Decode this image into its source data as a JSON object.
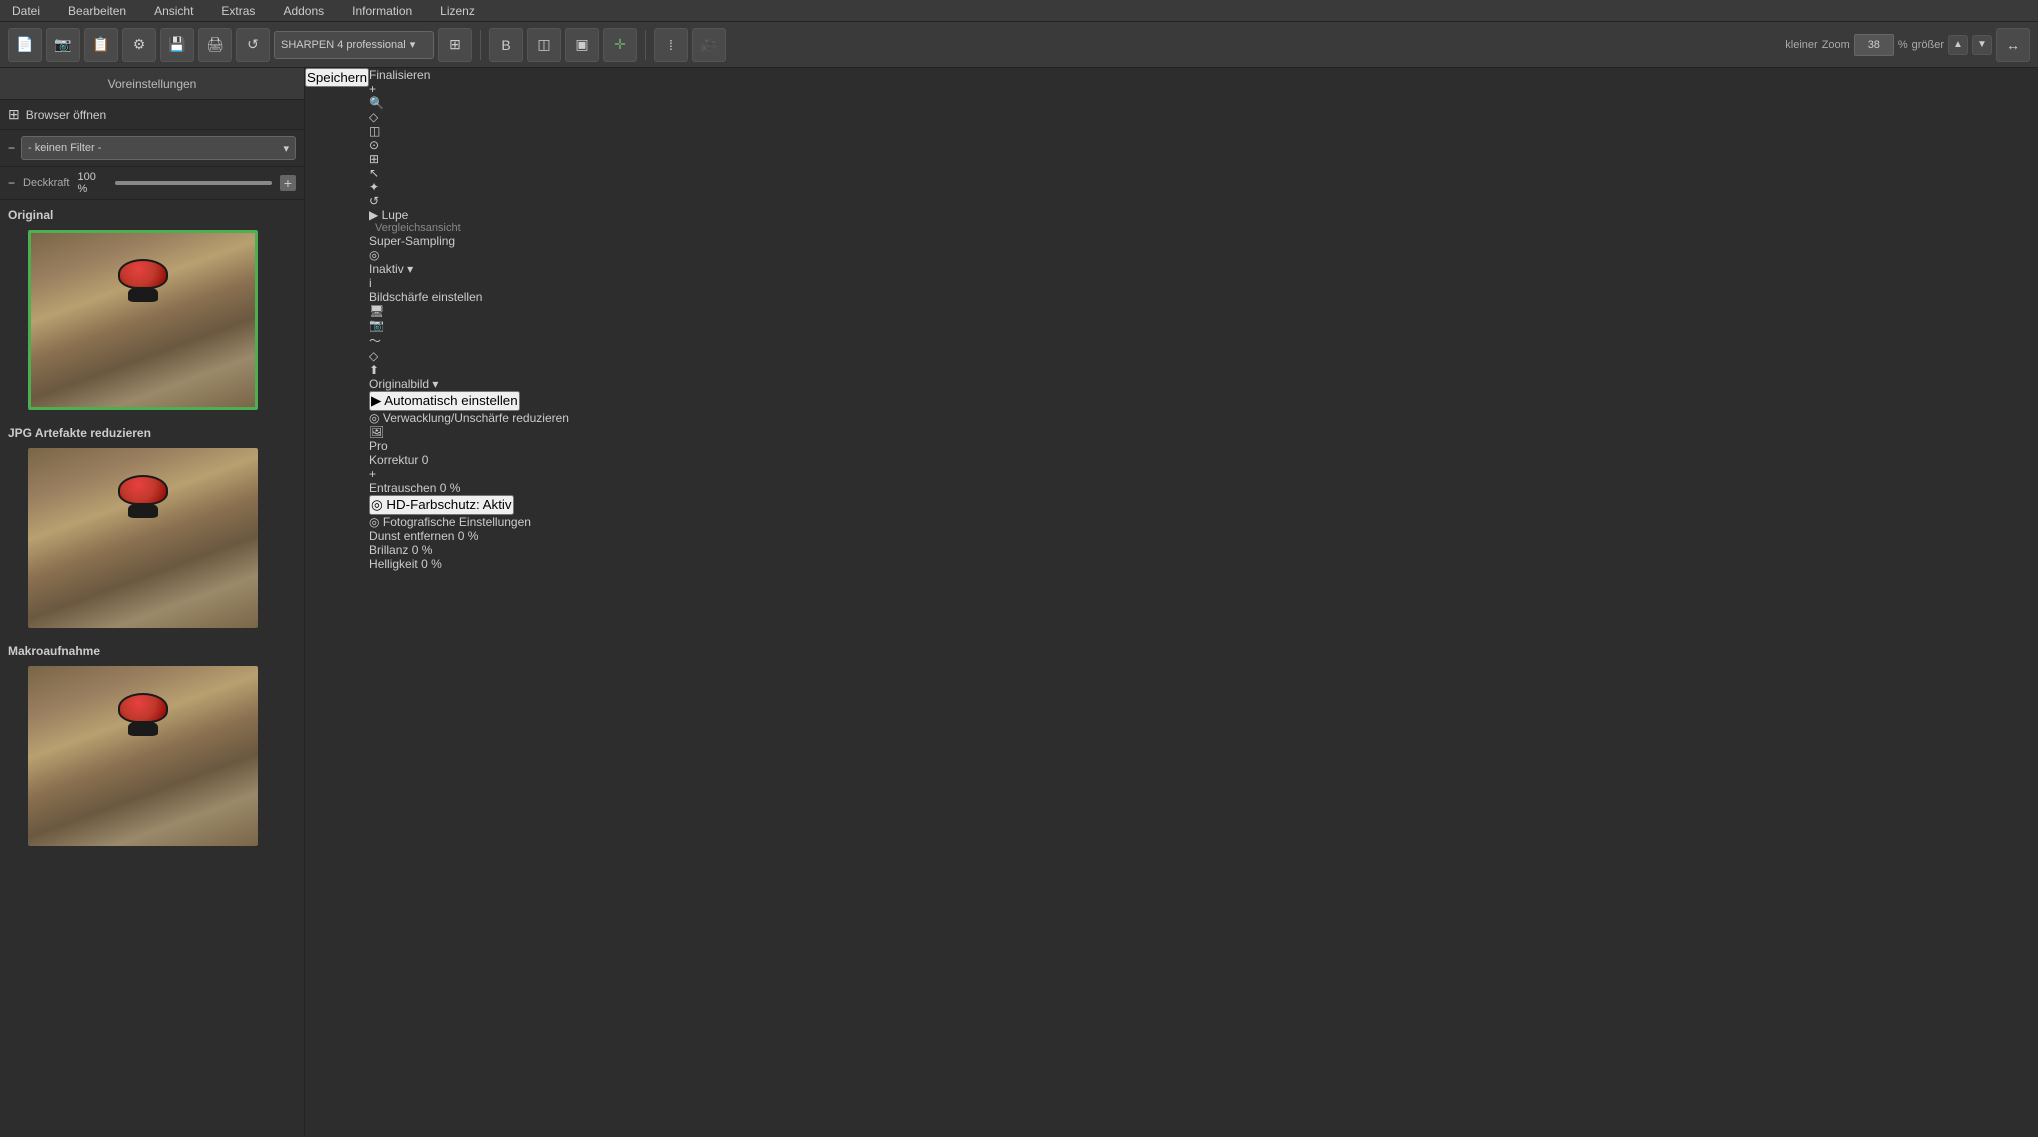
{
  "menu": {
    "items": [
      "Datei",
      "Bearbeiten",
      "Ansicht",
      "Extras",
      "Addons",
      "Information",
      "Lizenz"
    ]
  },
  "toolbar": {
    "plugin_label": "SHARPEN 4 professional",
    "zoom_smaller": "kleiner",
    "zoom_value": "38",
    "zoom_unit": "%",
    "zoom_larger": "größer"
  },
  "left_panel": {
    "title": "Voreinstellungen",
    "browser_btn": "Browser öffnen",
    "filter_label": "- keinen Filter -",
    "opacity_label": "Deckkraft",
    "opacity_value": "100",
    "opacity_unit": "%",
    "sections": [
      {
        "id": "original",
        "title": "Original",
        "selected": true
      },
      {
        "id": "jpg",
        "title": "JPG Artefakte reduzieren"
      },
      {
        "id": "makro",
        "title": "Makroaufnahme"
      }
    ]
  },
  "right_panel": {
    "title": "Finalisieren",
    "lupe": {
      "label": "Lupe",
      "compare_label": "Vergleichsansicht"
    },
    "super_sampling": {
      "title": "Super-Sampling",
      "value": "Inaktiv"
    },
    "sharpness": {
      "title": "Bildschärfe einstellen",
      "source_label": "Originalbild",
      "auto_btn": "Automatisch einstellen",
      "buttons": [
        "🖼",
        "📷",
        "〜",
        "◇",
        "⬆"
      ]
    },
    "blur_reduce": {
      "title": "Verwacklung/Unschärfe reduzieren",
      "pro_badge": "Pro",
      "slider_korrektur": {
        "label": "Korrektur",
        "value": "0"
      },
      "slider_entrauschen": {
        "label": "Entrauschen",
        "value": "0",
        "unit": "%"
      },
      "hd_btn": "HD-Farbschutz: Aktiv"
    },
    "photo_settings": {
      "title": "Fotografische Einstellungen",
      "dunst": {
        "label": "Dunst entfernen",
        "value": "0",
        "unit": "%"
      },
      "brillanz": {
        "label": "Brillanz",
        "value": "0",
        "unit": "%"
      },
      "helligkeit": {
        "label": "Helligkeit",
        "value": "0",
        "unit": "%"
      }
    }
  },
  "canvas": {
    "save_btn": "Speichern"
  },
  "icons": {
    "arrow_right": "▶",
    "arrow_down": "▼",
    "arrow_up": "▲",
    "grid": "⊞",
    "plus": "+",
    "minus": "−",
    "chevron_down": "▾",
    "settings": "⚙",
    "zoom_in": "🔍",
    "rotate": "↺",
    "compare": "◫",
    "info": "i",
    "star": "★",
    "lightning": "⚡",
    "refresh": "↻",
    "cursor": "↖",
    "move": "✥",
    "crop": "⌗"
  }
}
